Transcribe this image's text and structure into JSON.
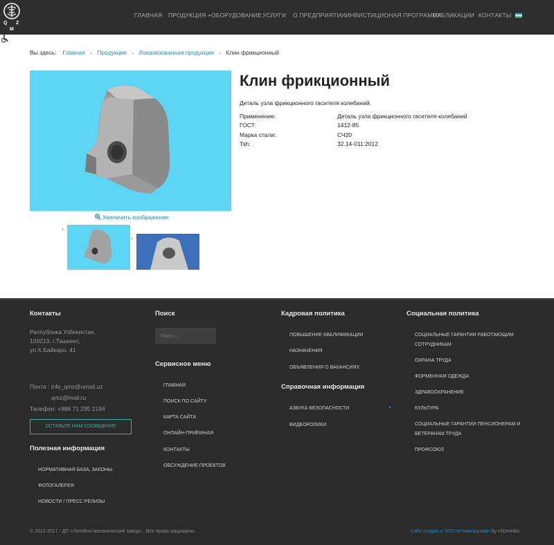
{
  "header": {
    "logo_letters": [
      "Q",
      "Z",
      "M"
    ],
    "nav": [
      {
        "label": "ГЛАВНАЯ"
      },
      {
        "label": "ПРОДУКЦИЯ +"
      },
      {
        "label": "ОБОРУДОВАНИЕ"
      },
      {
        "label": "УСЛУГИ"
      },
      {
        "label": "О ПРЕДПРИЯТИИ"
      },
      {
        "label": "ИНВИСТИЦИОНАЯ ПРОГРАММА"
      },
      {
        "label": "ПУБЛИКАЦИИ"
      },
      {
        "label": "КОНТАКТЫ"
      }
    ],
    "language_icon": "uzbekistan-flag-icon",
    "accessibility_icon": "wheelchair-icon"
  },
  "breadcrumb": {
    "prefix": "Вы здесь:",
    "items": [
      "Главная",
      "Продукция",
      "Локализованная продукция",
      "Клин фрикционный"
    ],
    "separator": "›"
  },
  "product": {
    "title": "Клин фрикционный",
    "description": "Деталь узла фрикционного гасителя колебаний.",
    "zoom_label": "Увеличить изображение",
    "specs": [
      {
        "label": "Применение:",
        "value": "Деталь узла фрикционного гасителя колебаний"
      },
      {
        "label": "ГОСТ:",
        "value": "1412-85"
      },
      {
        "label": "Марка стали:",
        "value": "СЧ20"
      },
      {
        "label": "Tsh:",
        "value": "32.14-011:2012"
      }
    ],
    "image_bg_color": "#5cd6f4"
  },
  "footer": {
    "contacts": {
      "heading": "Контакты",
      "address": [
        "Республика Узбекистан,",
        "100213, г.Ташкент,",
        "ул.Х.Байкаро, 41"
      ],
      "mail_label": "Почта : info_qmz@umail.uz",
      "mail2": "qmz@mail.ru",
      "phone": "Телефон: +998 71 295 2194",
      "button": "ОСТАВЬТЕ НАМ СООБЩЕНИЕ"
    },
    "useful": {
      "heading": "Полезная информация",
      "items": [
        "НОРМАТИВНАЯ БАЗА, ЗАКОНЫ",
        "ФОТОГАЛЕРЕЯ",
        "НОВОСТИ / ПРЕСС РЕЛИЗЫ"
      ]
    },
    "search": {
      "heading": "Поиск",
      "placeholder": "Поиск..."
    },
    "service": {
      "heading": "Сервисное меню",
      "items": [
        "ГЛАВНАЯ",
        "ПОИСК ПО САЙТУ",
        "КАРТА САЙТА",
        "ОНЛАЙН-ПРИЁМНАЯ",
        "КОНТАКТЫ",
        "ОБСУЖДЕНИЕ ПРОЕКТОВ"
      ]
    },
    "hr": {
      "heading": "Кадровая политика",
      "items": [
        "ПОВЫШЕНИЕ КВАЛИФИКАЦИИ",
        "НАЗНАЧЕНИЯ",
        "ОБЪЯВЛЕНИЯ О ВАКАНСИЯХ"
      ]
    },
    "reference": {
      "heading": "Справочная информация",
      "items": [
        "АЗБУКА БЕЗОПАСНОСТИ",
        "ВИДЕОРОЛИКИ"
      ]
    },
    "social": {
      "heading": "Социальная политика",
      "items": [
        [
          "СОЦИАЛЬНЫЕ ГАРАНТИИ РАБОТАЮЩИМ",
          "СОТРУДНИКАМ"
        ],
        [
          "ОХРАНА ТРУДА"
        ],
        [
          "ФОРМЕННАЯ ОДЕЖДА"
        ],
        [
          "ЗДРАВООХРАНЕНИЕ"
        ],
        [
          "КУЛЬТУРА"
        ],
        [
          "СОЦИАЛЬНЫЕ ГАРАНТИИ ПЕНСИОНЕРАМ И",
          "ВЕТЕРАНАМ ТРУДА"
        ],
        [
          "ПРОФСОЮЗ"
        ]
      ]
    },
    "copyright": "© 2012-2017 - ДП «Литейно-механический завод» . Все права защищены.",
    "credits_link": "Сайт создан и SEO оптимизирован",
    "credits_by": " by VIDmedia",
    "accent_color": "#2bb7b0",
    "link_color": "#1e8bc3"
  }
}
